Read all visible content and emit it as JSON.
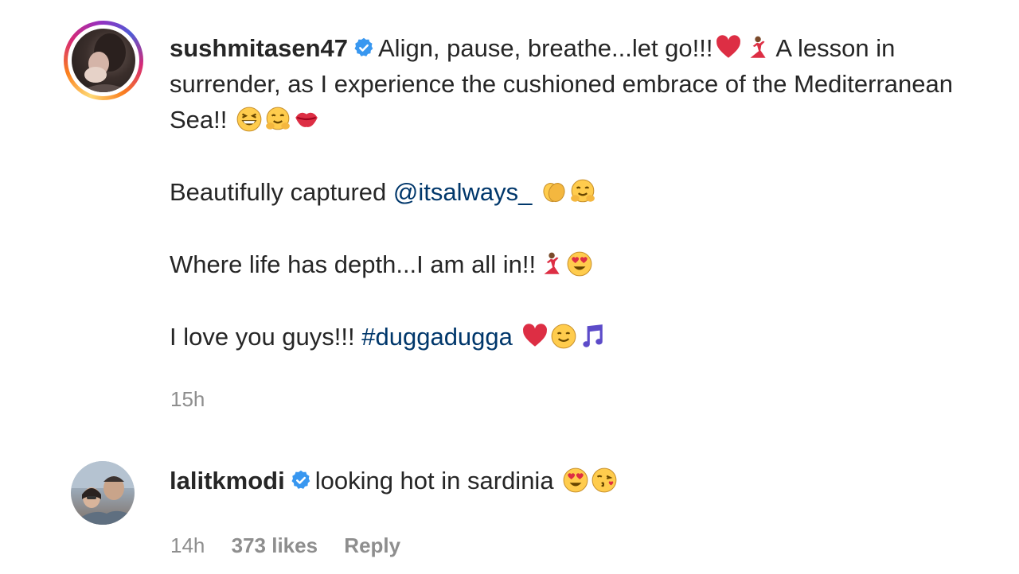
{
  "post": {
    "username": "sushmitasen47",
    "caption": {
      "line1": "Align, pause, breathe...let go!!!",
      "line1_tail": "A lesson in surrender, as I experience the cushioned embrace of the Mediterranean Sea!!",
      "para2_prefix": "Beautifully captured",
      "mention": "@itsalways_",
      "para3": "Where life has depth...I am all in!!",
      "para4_prefix": "I love you guys!!!",
      "hashtag": "#duggadugga"
    },
    "timestamp": "15h"
  },
  "comment": {
    "username": "lalitkmodi",
    "text": "looking hot in sardinia",
    "timestamp": "14h",
    "likes": "373 likes",
    "reply_label": "Reply"
  },
  "icons": {
    "verified": "verified-badge-icon",
    "colors": {
      "verified": "#3897f0",
      "link": "#00376b",
      "meta": "#8e8e8e",
      "text": "#262626"
    }
  }
}
